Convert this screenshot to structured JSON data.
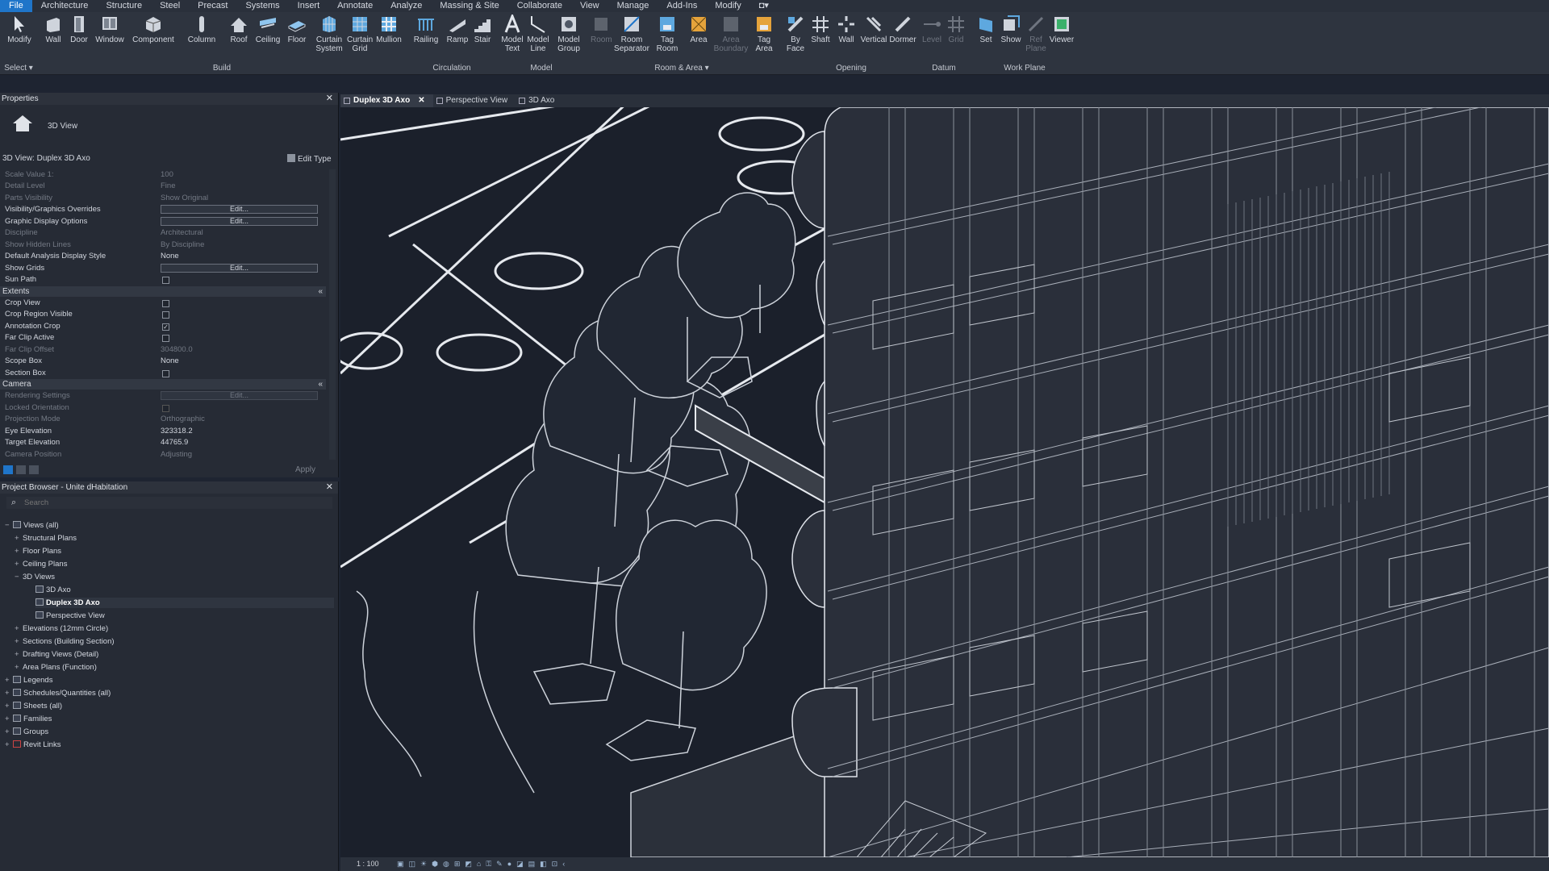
{
  "menu": [
    "File",
    "Architecture",
    "Structure",
    "Steel",
    "Precast",
    "Systems",
    "Insert",
    "Annotate",
    "Analyze",
    "Massing & Site",
    "Collaborate",
    "View",
    "Manage",
    "Add-Ins",
    "Modify"
  ],
  "ribbon": {
    "modify": "Modify",
    "select": "Select ▾",
    "wall": "Wall",
    "door": "Door",
    "window": "Window",
    "component": "Component",
    "column": "Column",
    "roof": "Roof",
    "ceiling": "Ceiling",
    "floor": "Floor",
    "curtain_system": "Curtain System",
    "curtain_grid": "Curtain Grid",
    "mullion": "Mullion",
    "railing": "Railing",
    "ramp": "Ramp",
    "stair": "Stair",
    "model_text": "Model Text",
    "model_line": "Model Line",
    "model_group": "Model Group",
    "room": "Room",
    "room_separator": "Room Separator",
    "tag_room": "Tag Room",
    "area": "Area",
    "area_boundary": "Area Boundary",
    "tag_area": "Tag Area",
    "by_face": "By Face",
    "shaft": "Shaft",
    "wall_opening": "Wall",
    "vertical": "Vertical",
    "dormer": "Dormer",
    "level": "Level",
    "grid": "Grid",
    "set": "Set",
    "show": "Show",
    "ref_plane": "Ref Plane",
    "viewer": "Viewer",
    "groups": {
      "build": "Build",
      "circulation": "Circulation",
      "model": "Model",
      "room_area": "Room & Area ▾",
      "opening": "Opening",
      "datum": "Datum",
      "work_plane": "Work Plane"
    }
  },
  "properties": {
    "title": "Properties",
    "type_name": "3D View",
    "instance": "3D View: Duplex 3D Axo",
    "edit_type": "Edit Type",
    "rows": {
      "scale_value": {
        "k": "Scale Value    1:",
        "v": "100"
      },
      "detail_level": {
        "k": "Detail Level",
        "v": "Fine"
      },
      "parts_visibility": {
        "k": "Parts Visibility",
        "v": "Show Original"
      },
      "vg_overrides": {
        "k": "Visibility/Graphics Overrides",
        "v": "Edit..."
      },
      "graphic_display": {
        "k": "Graphic Display Options",
        "v": "Edit..."
      },
      "discipline": {
        "k": "Discipline",
        "v": "Architectural"
      },
      "hidden_lines": {
        "k": "Show Hidden Lines",
        "v": "By Discipline"
      },
      "analysis_style": {
        "k": "Default Analysis Display Style",
        "v": "None"
      },
      "show_grids": {
        "k": "Show Grids",
        "v": "Edit..."
      },
      "sun_path": {
        "k": "Sun Path"
      },
      "crop_view": {
        "k": "Crop View"
      },
      "crop_region": {
        "k": "Crop Region Visible"
      },
      "annotation_crop": {
        "k": "Annotation Crop"
      },
      "far_clip_active": {
        "k": "Far Clip Active"
      },
      "far_clip_offset": {
        "k": "Far Clip Offset",
        "v": "304800.0"
      },
      "scope_box": {
        "k": "Scope Box",
        "v": "None"
      },
      "section_box": {
        "k": "Section Box"
      },
      "rendering": {
        "k": "Rendering Settings",
        "v": "Edit..."
      },
      "locked_orientation": {
        "k": "Locked Orientation"
      },
      "projection_mode": {
        "k": "Projection Mode",
        "v": "Orthographic"
      },
      "eye_elevation": {
        "k": "Eye Elevation",
        "v": "323318.2"
      },
      "target_elevation": {
        "k": "Target Elevation",
        "v": "44765.9"
      },
      "camera_position": {
        "k": "Camera Position",
        "v": "Adjusting"
      }
    },
    "sections": {
      "extents": "Extents",
      "camera": "Camera"
    },
    "apply": "Apply"
  },
  "browser": {
    "title": "Project Browser - Unite dHabitation",
    "search_placeholder": "Search",
    "items": [
      "Views (all)",
      "Structural Plans",
      "Floor Plans",
      "Ceiling Plans",
      "3D Views",
      "3D Axo",
      "Duplex 3D Axo",
      "Perspective View",
      "Elevations (12mm Circle)",
      "Sections (Building Section)",
      "Drafting Views (Detail)",
      "Area Plans (Function)",
      "Legends",
      "Schedules/Quantities (all)",
      "Sheets (all)",
      "Families",
      "Groups",
      "Revit Links"
    ]
  },
  "tabs": [
    "Duplex 3D Axo",
    "Perspective View",
    "3D Axo"
  ],
  "status": {
    "scale": "1 : 100"
  }
}
